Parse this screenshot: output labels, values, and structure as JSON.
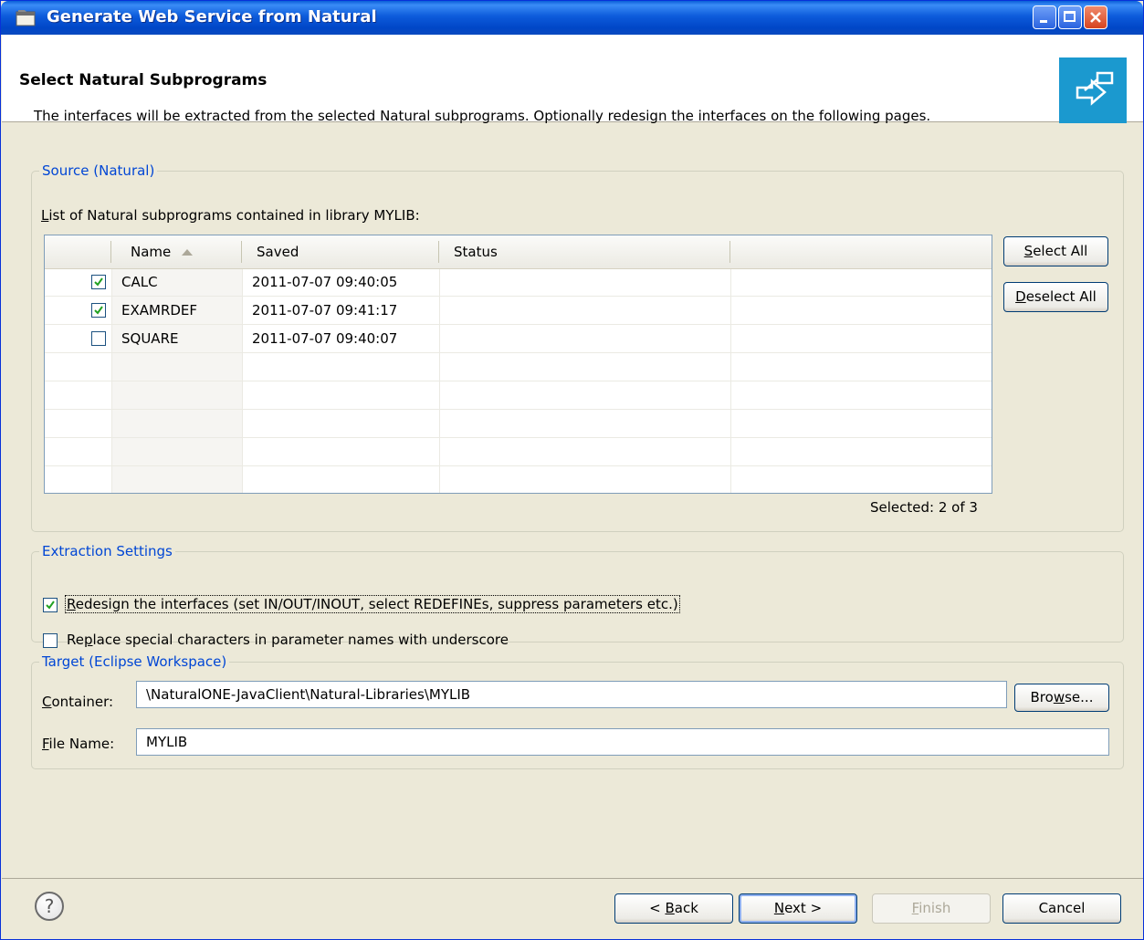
{
  "window": {
    "title": "Generate Web Service from Natural"
  },
  "header": {
    "title": "Select Natural Subprograms",
    "description": "The interfaces will be extracted from the selected Natural subprograms. Optionally redesign the interfaces on the following pages."
  },
  "source": {
    "group_label": "Source (Natural)",
    "list_label_prefix": "L",
    "list_label_rest": "ist of Natural subprograms contained in library MYLIB:",
    "columns": [
      "Name",
      "Saved",
      "Status",
      ""
    ],
    "rows": [
      {
        "name": "CALC",
        "saved": "2011-07-07 09:40:05",
        "status": "",
        "checked": true
      },
      {
        "name": "EXAMRDEF",
        "saved": "2011-07-07 09:41:17",
        "status": "",
        "checked": true
      },
      {
        "name": "SQUARE",
        "saved": "2011-07-07 09:40:07",
        "status": "",
        "checked": false
      }
    ],
    "select_all": {
      "mn": "S",
      "rest": "elect All"
    },
    "deselect_all": {
      "mn": "D",
      "rest": "eselect All"
    },
    "selected_count": "Selected: 2 of 3"
  },
  "extraction": {
    "group_label": "Extraction Settings",
    "redesign": {
      "mn": "R",
      "rest": "edesign the interfaces (set IN/OUT/INOUT, select REDEFINEs, suppress parameters etc.)",
      "checked": true
    },
    "replace": {
      "pre": "Re",
      "mn": "p",
      "rest": "lace special characters in parameter names with underscore",
      "checked": false
    }
  },
  "target": {
    "group_label": "Target (Eclipse Workspace)",
    "container_label": {
      "mn": "C",
      "rest": "ontainer:"
    },
    "container_value": "\\NaturalONE-JavaClient\\Natural-Libraries\\MYLIB",
    "browse": {
      "pre": "Bro",
      "mn": "w",
      "rest": "se..."
    },
    "file_label": {
      "mn": "F",
      "rest": "ile Name:"
    },
    "file_value": "MYLIB"
  },
  "footer": {
    "help": "?",
    "back": {
      "pre": "< ",
      "mn": "B",
      "rest": "ack"
    },
    "next": {
      "mn": "N",
      "rest": "ext >"
    },
    "finish": {
      "mn": "F",
      "rest": "inish"
    },
    "cancel": "Cancel"
  },
  "colors": {
    "accent": "#0046d5",
    "title_bar": "#0054e3",
    "banner": "#1b99cf"
  }
}
